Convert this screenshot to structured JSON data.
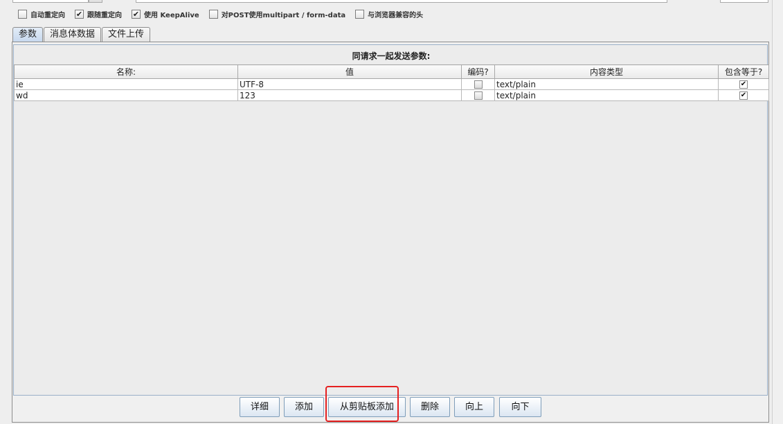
{
  "options": [
    {
      "label": "自动重定向",
      "checked": false
    },
    {
      "label": "跟随重定向",
      "checked": true
    },
    {
      "label": "使用 KeepAlive",
      "checked": true
    },
    {
      "label": "对POST使用multipart / form-data",
      "checked": false
    },
    {
      "label": "与浏览器兼容的头",
      "checked": false
    }
  ],
  "tabs": [
    "参数",
    "消息体数据",
    "文件上传"
  ],
  "panel": {
    "title": "同请求一起发送参数:",
    "columns": [
      "名称:",
      "值",
      "编码?",
      "内容类型",
      "包含等于?"
    ],
    "rows": [
      {
        "name": "ie",
        "value": "UTF-8",
        "encode": false,
        "content_type": "text/plain",
        "include_equals": true
      },
      {
        "name": "wd",
        "value": "123",
        "encode": false,
        "content_type": "text/plain",
        "include_equals": true
      }
    ]
  },
  "buttons": [
    "详细",
    "添加",
    "从剪贴板添加",
    "删除",
    "向上",
    "向下"
  ],
  "check_mark": "✔",
  "colors": {
    "highlight": "#e52020",
    "active_tab": "#c6d8ee"
  }
}
